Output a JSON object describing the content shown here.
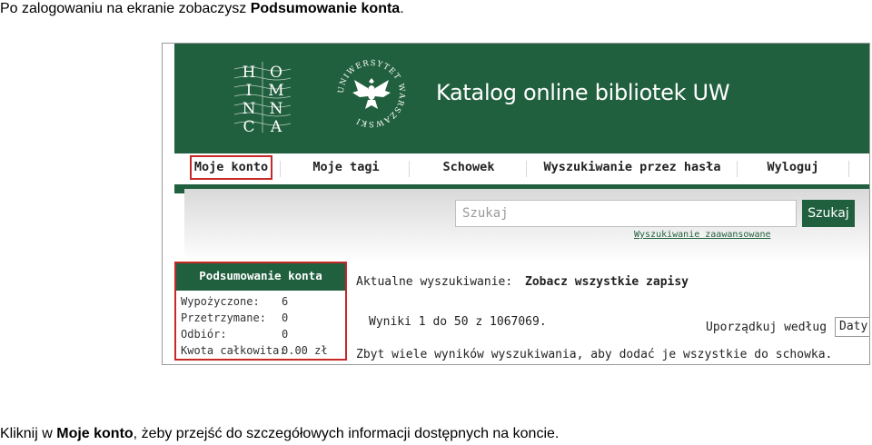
{
  "caption_top": {
    "text": "Po zalogowaniu na ekranie zobaczysz ",
    "bold": "Podsumowanie konta",
    "after": "."
  },
  "caption_bottom": {
    "before": "Kliknij w ",
    "bold": "Moje konto",
    "after": ", żeby przejść do szczegółowych informacji dostępnych na koncie."
  },
  "header": {
    "title": "Katalog online bibliotek UW",
    "logo_letters": [
      "H",
      "O",
      "I",
      "M",
      "N",
      "N",
      "C",
      "A"
    ],
    "seal_text": "UNIWERSYTET WARSZAWSKI",
    "bg_color": "#21603e"
  },
  "nav": {
    "items": [
      {
        "label": "Moje konto",
        "active": true
      },
      {
        "label": "Moje tagi"
      },
      {
        "label": "Schowek"
      },
      {
        "label": "Wyszukiwanie przez hasła"
      },
      {
        "label": "Wyloguj"
      }
    ]
  },
  "search": {
    "placeholder": "Szukaj",
    "button_label": "Szukaj",
    "advanced_link": "Wyszukiwanie zaawansowane"
  },
  "summary": {
    "title": "Podsumowanie konta",
    "rows": [
      {
        "label": "Wypożyczone:",
        "value": "6"
      },
      {
        "label": "Przetrzymane:",
        "value": "0"
      },
      {
        "label": "Odbiór:",
        "value": "0"
      },
      {
        "label": "Kwota całkowita:",
        "value": "0.00 zł"
      }
    ]
  },
  "results": {
    "current_search_label": "Aktualne wyszukiwanie:",
    "current_search_value": "Zobacz wszystkie zapisy",
    "count_text": "Wyniki 1 do 50 z 1067069.",
    "sort_label": "Uporządkuj według",
    "sort_value": "Daty",
    "too_many_text": "Zbyt wiele wyników wyszukiwania, aby dodać je wszystkie do schowka."
  },
  "colors": {
    "accent": "#21603e",
    "highlight": "#c62828"
  }
}
